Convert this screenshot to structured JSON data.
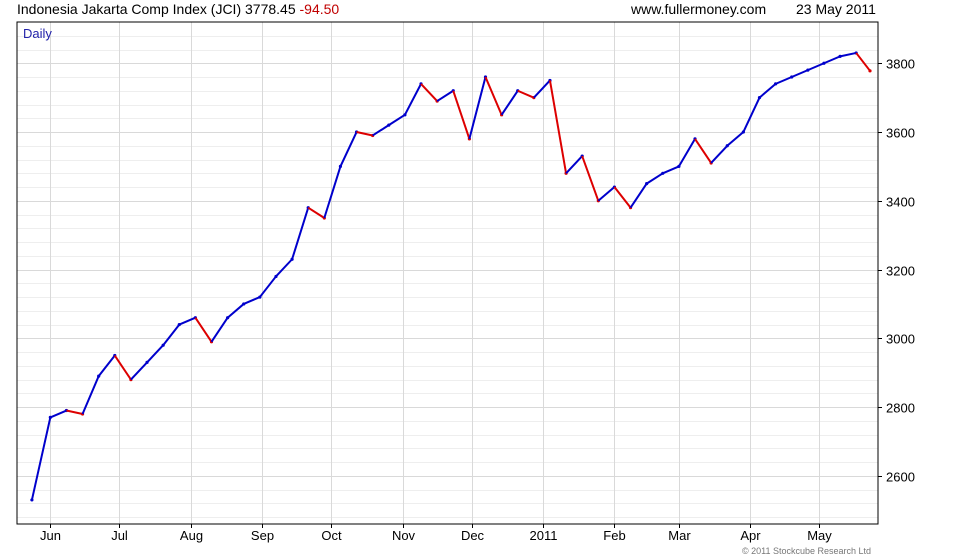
{
  "header": {
    "title": "Indonesia Jakarta Comp Index (JCI)",
    "last": "3778.45",
    "change": "-94.50",
    "site": "www.fullermoney.com",
    "date": "23 May 2011"
  },
  "credit": "© 2011 Stockcube Research Ltd",
  "colors": {
    "up": "#0000cc",
    "down": "#dd0000",
    "grid": "#d9d9d9",
    "axis": "#000000",
    "label": "#000000",
    "period": "#2222aa"
  },
  "chart_data": {
    "type": "line",
    "title": "Indonesia Jakarta Comp Index (JCI)",
    "period_label": "Daily",
    "ylim": [
      2460,
      3920
    ],
    "yticks": [
      2600,
      2800,
      3000,
      3200,
      3400,
      3600,
      3800
    ],
    "grid": true,
    "x_ticks": [
      "Jun",
      "Jul",
      "Aug",
      "Sep",
      "Oct",
      "Nov",
      "Dec",
      "2011",
      "Feb",
      "Mar",
      "Apr",
      "May"
    ],
    "series": [
      {
        "x": [
          "2010-05-24",
          "2010-06-01",
          "2010-06-08",
          "2010-06-15",
          "2010-06-22",
          "2010-06-29",
          "2010-07-06",
          "2010-07-13",
          "2010-07-20",
          "2010-07-27",
          "2010-08-03",
          "2010-08-10",
          "2010-08-17",
          "2010-08-24",
          "2010-08-31",
          "2010-09-07",
          "2010-09-14",
          "2010-09-21",
          "2010-09-28",
          "2010-10-05",
          "2010-10-12",
          "2010-10-19",
          "2010-10-26",
          "2010-11-02",
          "2010-11-09",
          "2010-11-16",
          "2010-11-23",
          "2010-11-30",
          "2010-12-07",
          "2010-12-14",
          "2010-12-21",
          "2010-12-28",
          "2011-01-04",
          "2011-01-11",
          "2011-01-18",
          "2011-01-25",
          "2011-02-01",
          "2011-02-08",
          "2011-02-15",
          "2011-02-22",
          "2011-03-01",
          "2011-03-08",
          "2011-03-15",
          "2011-03-22",
          "2011-03-29",
          "2011-04-05",
          "2011-04-12",
          "2011-04-19",
          "2011-04-26",
          "2011-05-03",
          "2011-05-10",
          "2011-05-17",
          "2011-05-23"
        ],
        "values": [
          2530,
          2770,
          2790,
          2780,
          2890,
          2950,
          2880,
          2930,
          2980,
          3040,
          3060,
          2990,
          3060,
          3100,
          3120,
          3180,
          3230,
          3380,
          3350,
          3500,
          3600,
          3590,
          3620,
          3650,
          3740,
          3690,
          3720,
          3580,
          3760,
          3650,
          3720,
          3700,
          3750,
          3480,
          3530,
          3400,
          3440,
          3380,
          3450,
          3480,
          3500,
          3580,
          3510,
          3560,
          3600,
          3700,
          3740,
          3760,
          3780,
          3800,
          3820,
          3830,
          3778
        ]
      }
    ]
  }
}
